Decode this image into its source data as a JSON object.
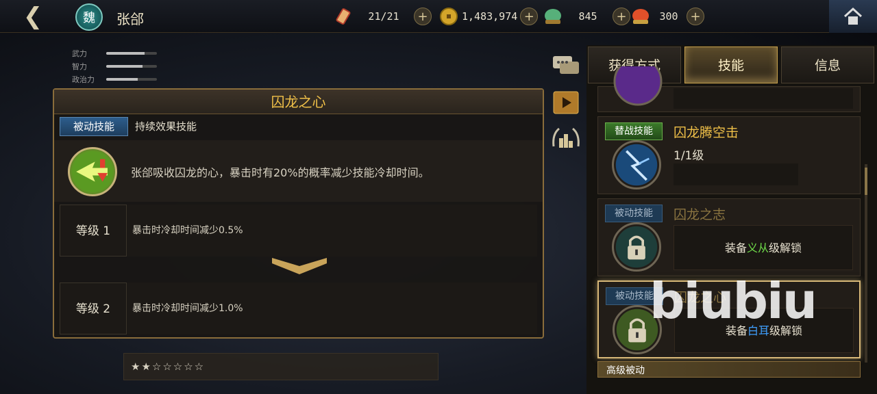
{
  "header": {
    "back_icon": "chevron-left-icon",
    "kingdom": "魏",
    "hero_name": "张郃",
    "resources": [
      {
        "icon": "scroll-icon",
        "value": "21/21",
        "color": "#c0392b"
      },
      {
        "icon": "coin-icon",
        "value": "1,483,974",
        "color": "#d4a52a"
      },
      {
        "icon": "jade-icon",
        "value": "845",
        "color": "#57b07a"
      },
      {
        "icon": "ruby-icon",
        "value": "300",
        "color": "#e0502a"
      }
    ],
    "home_icon": "home-icon"
  },
  "stats": [
    {
      "label": "武力",
      "level": 0.75
    },
    {
      "label": "智力",
      "level": 0.72
    },
    {
      "label": "政治力",
      "level": 0.62
    }
  ],
  "skill_detail": {
    "title": "囚龙之心",
    "type_tag": "被动技能",
    "subtype": "持续效果技能",
    "description": "张郃吸收囚龙的心，暴击时有20%的概率减少技能冷却时间。",
    "levels": [
      {
        "label": "等级 1",
        "text": "暴击时冷却时间减少0.5%"
      },
      {
        "label": "等级 2",
        "text": "暴击时冷却时间减少1.0%"
      }
    ]
  },
  "tabs": [
    {
      "label": "获得方式",
      "active": false
    },
    {
      "label": "技能",
      "active": true
    },
    {
      "label": "信息",
      "active": false
    }
  ],
  "skill_list": {
    "card1": {
      "tag": "替战技能",
      "title": "囚龙腾空击",
      "level": "1/1级"
    },
    "card2": {
      "tag": "被动技能",
      "title": "囚龙之志",
      "unlock_prefix": "装备",
      "unlock_hl": "义从",
      "unlock_suffix": "级解锁"
    },
    "card3": {
      "tag": "被动技能",
      "title": "囚龙之心",
      "unlock_prefix": "装备",
      "unlock_hl": "白耳",
      "unlock_suffix": "级解锁"
    },
    "advanced_label": "高级被动"
  },
  "watermark": "biubiu",
  "colors": {
    "gold": "#f0c048",
    "accent_blue": "#3fa0ff",
    "accent_green": "#6fdc4a"
  }
}
